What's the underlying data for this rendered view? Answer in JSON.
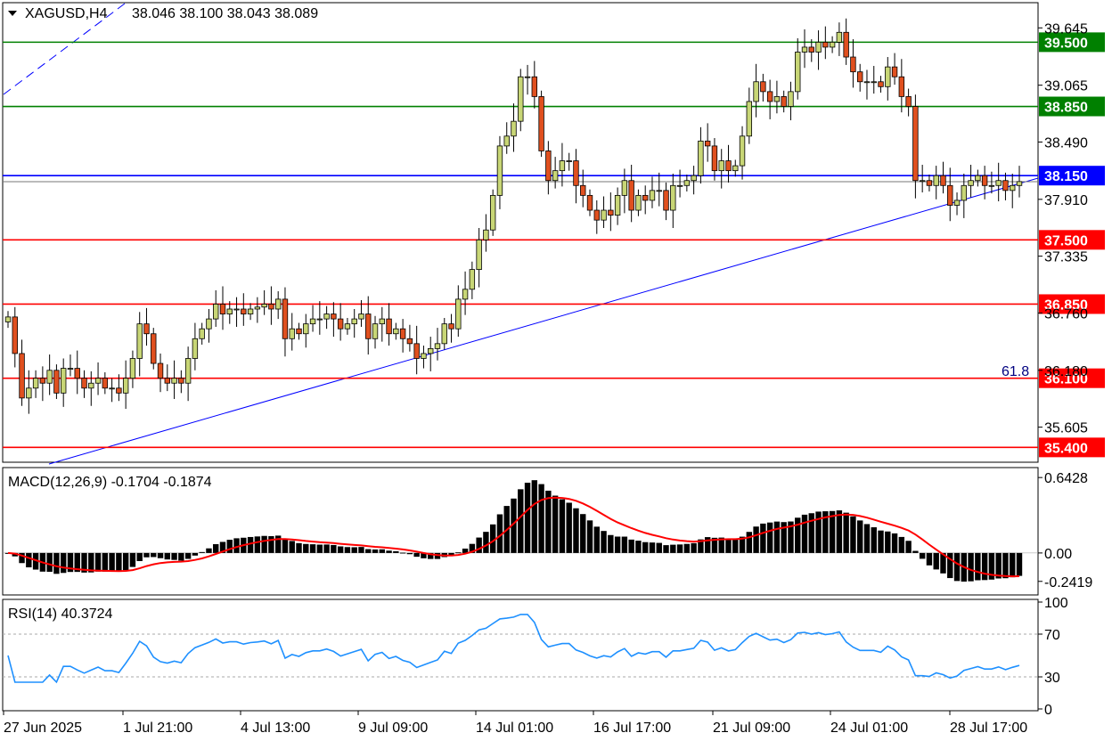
{
  "header": {
    "symbol": "XAGUSD,H4",
    "ohlc": "38.046 38.100 38.043 38.089"
  },
  "chart_data": {
    "type": "candlestick",
    "x_labels": [
      "27 Jun 2025",
      "1 Jul 21:00",
      "4 Jul 13:00",
      "9 Jul 09:00",
      "14 Jul 01:00",
      "16 Jul 17:00",
      "21 Jul 09:00",
      "24 Jul 01:00",
      "28 Jul 17:00"
    ],
    "price_ticks": [
      "39.645",
      "39.065",
      "38.490",
      "37.910",
      "37.335",
      "36.760",
      "36.180",
      "35.605"
    ],
    "price_range": [
      35.25,
      39.9
    ],
    "level_lines": [
      {
        "price": 39.5,
        "label": "39.500",
        "color": "#008000"
      },
      {
        "price": 38.85,
        "label": "38.850",
        "color": "#008000"
      },
      {
        "price": 38.15,
        "label": "38.150",
        "color": "#0000ff"
      },
      {
        "price": 37.5,
        "label": "37.500",
        "color": "#ff0000"
      },
      {
        "price": 36.85,
        "label": "36.850",
        "color": "#ff0000"
      },
      {
        "price": 36.1,
        "label": "36.100",
        "color": "#ff0000"
      },
      {
        "price": 35.4,
        "label": "35.400",
        "color": "#ff0000"
      }
    ],
    "fib_label": "61.8",
    "price_close_line": 38.089,
    "candles_close": [
      36.72,
      36.35,
      35.9,
      36.0,
      36.1,
      36.05,
      36.18,
      35.95,
      36.2,
      36.2,
      36.1,
      36.0,
      36.05,
      36.1,
      36.0,
      36.0,
      35.95,
      36.1,
      36.3,
      36.65,
      36.55,
      36.25,
      36.1,
      36.05,
      36.1,
      36.05,
      36.3,
      36.5,
      36.6,
      36.7,
      36.85,
      36.75,
      36.8,
      36.8,
      36.75,
      36.8,
      36.82,
      36.85,
      36.8,
      36.9,
      36.5,
      36.6,
      36.55,
      36.65,
      36.7,
      36.7,
      36.75,
      36.7,
      36.6,
      36.65,
      36.7,
      36.75,
      36.5,
      36.65,
      36.7,
      36.55,
      36.6,
      36.5,
      36.45,
      36.3,
      36.35,
      36.4,
      36.45,
      36.65,
      36.6,
      36.9,
      37.0,
      37.2,
      37.5,
      37.6,
      37.95,
      38.45,
      38.55,
      38.7,
      39.15,
      39.15,
      38.95,
      38.4,
      38.1,
      38.2,
      38.3,
      38.3,
      38.05,
      37.95,
      37.8,
      37.7,
      37.8,
      37.75,
      37.95,
      38.1,
      37.8,
      37.95,
      37.9,
      38.0,
      38.0,
      37.8,
      38.05,
      38.05,
      38.1,
      38.15,
      38.5,
      38.45,
      38.2,
      38.3,
      38.2,
      38.25,
      38.55,
      38.9,
      39.1,
      39.0,
      38.9,
      38.95,
      38.85,
      39.0,
      39.4,
      39.45,
      39.4,
      39.5,
      39.45,
      39.5,
      39.6,
      39.35,
      39.2,
      39.1,
      39.1,
      39.1,
      39.05,
      39.25,
      39.15,
      38.95,
      38.85,
      38.1,
      38.1,
      38.05,
      38.15,
      38.05,
      37.85,
      37.9,
      38.05,
      38.1,
      38.15,
      38.05,
      38.05,
      38.1,
      38.0,
      38.05,
      38.09
    ],
    "macd": {
      "label": "MACD(12,26,9) -0.1704 -0.1874",
      "ticks": [
        "0.6428",
        "0.00",
        "-0.2419"
      ],
      "range": [
        -0.35,
        0.72
      ]
    },
    "rsi": {
      "label": "RSI(14) 40.3724",
      "ticks": [
        "100",
        "70",
        "30",
        "0"
      ],
      "levels": [
        70,
        30
      ]
    },
    "colors": {
      "bull": "#c8d676",
      "bear": "#e0501f",
      "macd_signal": "#ff0000",
      "rsi_line": "#1e90ff",
      "trendline": "#0000ff"
    }
  }
}
